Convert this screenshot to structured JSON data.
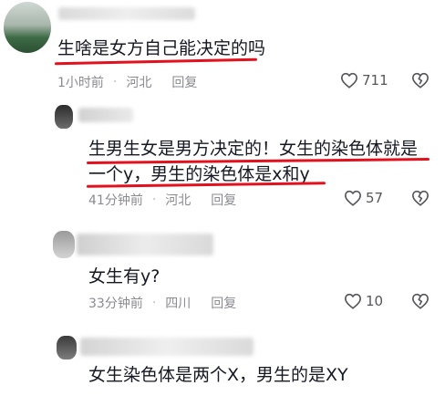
{
  "comments": [
    {
      "text": "生啥是女方自己能决定的吗",
      "time": "1小时前",
      "location": "河北",
      "reply_label": "回复",
      "like_count": "711"
    },
    {
      "text_line1": "生男生女是男方决定的！女生的染色体就是",
      "text_line2": "一个y，男生的染色体是x和y",
      "time": "41分钟前",
      "location": "河北",
      "reply_label": "回复",
      "like_count": "57"
    },
    {
      "text": "女生有y?",
      "time": "33分钟前",
      "location": "四川",
      "reply_label": "回复",
      "like_count": "10"
    },
    {
      "text": "女生染色体是两个X，男生的是XY"
    }
  ],
  "separator": "·",
  "colors": {
    "underline": "#e3111d",
    "meta_text": "#8a8b91",
    "body_text": "#161823"
  },
  "icons": {
    "like": "heart-icon",
    "dislike": "broken-heart-icon"
  }
}
